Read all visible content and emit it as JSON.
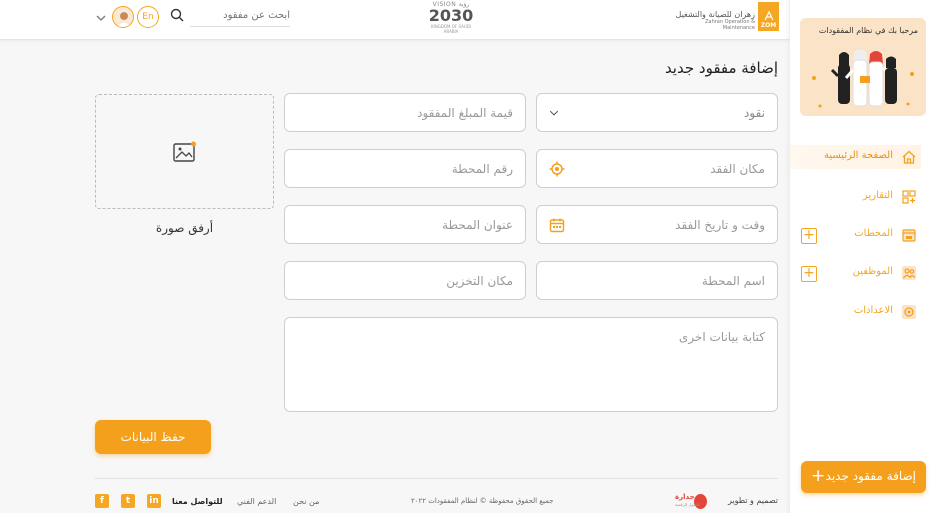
{
  "header": {
    "lang_label": "En",
    "search_placeholder": "ابحث عن مفقود",
    "vision_top": "VISION رؤیة",
    "vision_year": "2030",
    "vision_sub": "KINGDOM OF SAUDI ARABIA",
    "company_ar": "زهران للصيانة والتشغيل",
    "company_en": "Zahran Operation & Maintenance",
    "company_badge": "ZOM"
  },
  "form": {
    "title": "إضافة مفقود جديد",
    "category_value": "نقود",
    "amount_placeholder": "قيمة المبلغ المفقود",
    "loss_place_placeholder": "مكان الفقد",
    "station_number_placeholder": "رقم المحطة",
    "datetime_placeholder": "وقت و تاريخ الفقد",
    "station_address_placeholder": "عنوان المحطة",
    "station_name_placeholder": "اسم المحطة",
    "storage_place_placeholder": "مكان التخزين",
    "other_data_placeholder": "كتابة بيانات اخرى",
    "attach_image_label": "أرفق صورة",
    "save_label": "حفظ البيانات"
  },
  "footer": {
    "contact_label": "للتواصل معنا",
    "support_label": "الدعم الفني",
    "about_label": "من نحن",
    "copyright": "جميع الحقوق محفوظة © لنظام المفقودات ٢٠٢٢",
    "design_label": "تصميم و تطوير",
    "design_brand": "جدارة",
    "design_brand_sub": "للحلول الرقمية",
    "social_facebook": "f",
    "social_twitter": "t",
    "social_linkedin": "in"
  },
  "sidebar": {
    "banner_title": "مرحبا بك في نظام المفقودات",
    "items": [
      {
        "label": "الصفحة الرئيسية",
        "icon": "home-icon"
      },
      {
        "label": "التقارير",
        "icon": "reports-icon"
      },
      {
        "label": "المحطات",
        "icon": "stations-icon"
      },
      {
        "label": "الموظفين",
        "icon": "employees-icon"
      },
      {
        "label": "الاعدادات",
        "icon": "settings-icon"
      }
    ],
    "add_button_label": "إضافة مفقود جديد",
    "add_button_plus": "+"
  },
  "colors": {
    "accent": "#f5a01d",
    "accent_light": "#fbe3c7",
    "border": "#cfcfcf"
  }
}
